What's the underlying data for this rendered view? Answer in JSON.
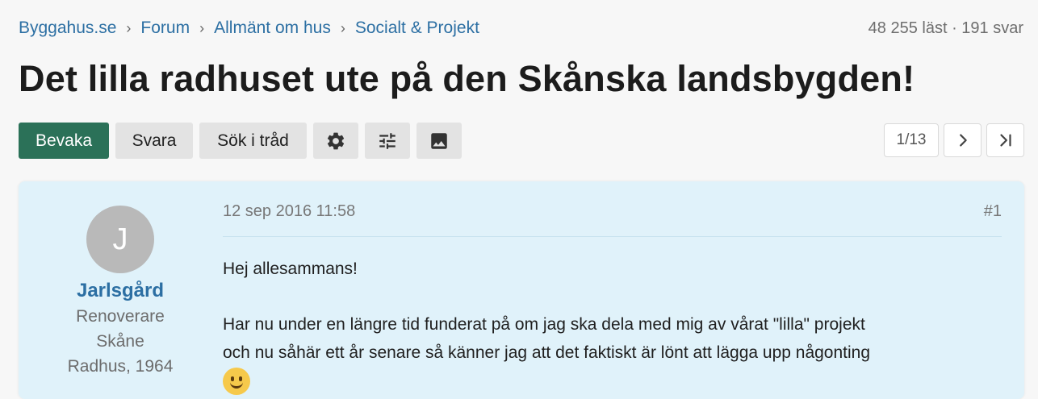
{
  "breadcrumb": {
    "items": [
      "Byggahus.se",
      "Forum",
      "Allmänt om hus",
      "Socialt & Projekt"
    ],
    "separator": "›"
  },
  "stats": "48 255 läst · 191 svar",
  "thread": {
    "title": "Det lilla radhuset ute på den Skånska landsbygden!"
  },
  "actions": {
    "watch": "Bevaka",
    "reply": "Svara",
    "search": "Sök i tråd",
    "icons": [
      "gear-icon",
      "sliders-icon",
      "image-icon"
    ]
  },
  "pagination": {
    "page": "1/13",
    "next_icon": "chevron-right-icon",
    "last_icon": "skip-last-icon"
  },
  "post": {
    "avatar_letter": "J",
    "username": "Jarlsgård",
    "role": "Renoverare",
    "region": "Skåne",
    "house": "Radhus, 1964",
    "timestamp": "12 sep 2016 11:58",
    "number": "#1",
    "paragraphs": [
      "Hej allesammans!",
      "Har nu under en längre tid funderat på om jag ska dela med mig av vårat \"lilla\" projekt",
      "och nu såhär ett år senare så känner jag att det faktiskt är lönt att lägga upp någonting"
    ],
    "emoji": "slightly-smiling-face-icon"
  },
  "colors": {
    "link": "#2c6fa3",
    "primary_button": "#2b7158",
    "post_background": "#e0f2fa"
  }
}
